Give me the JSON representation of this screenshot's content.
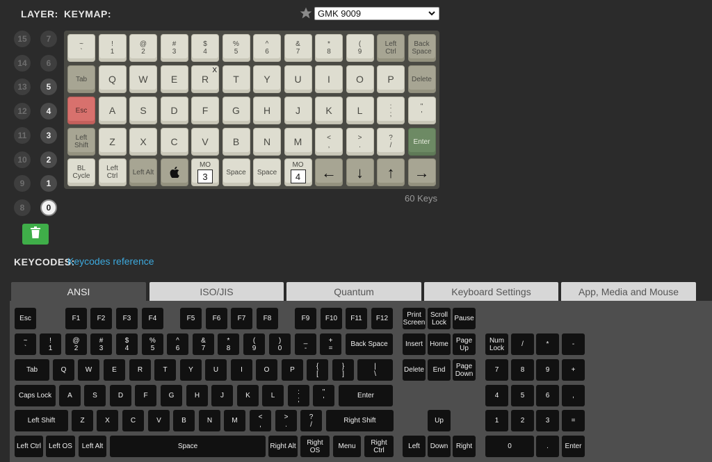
{
  "header": {
    "layer_label": "LAYER:",
    "keymap_label": "KEYMAP:",
    "preset_value": "GMK 9009",
    "preset_options": [
      "GMK 9009"
    ]
  },
  "layers": {
    "left": [
      "15",
      "14",
      "13",
      "12",
      "11",
      "10",
      "9",
      "8"
    ],
    "right": [
      "7",
      "6",
      "5",
      "4",
      "3",
      "2",
      "1",
      "0"
    ],
    "active": "0"
  },
  "colors": {
    "accent_link": "#3da9dd",
    "trash_green": "#3fae49",
    "keycap_light": "#deddd0",
    "keycap_dark": "#a7a593",
    "keycap_red": "#d8716d",
    "keycap_green": "#6d8a64"
  },
  "keymap_rows": [
    [
      {
        "t": "~",
        "b": "`",
        "s": "c1"
      },
      {
        "t": "!",
        "b": "1",
        "s": "c1"
      },
      {
        "t": "@",
        "b": "2",
        "s": "c1"
      },
      {
        "t": "#",
        "b": "3",
        "s": "c1"
      },
      {
        "t": "$",
        "b": "4",
        "s": "c1"
      },
      {
        "t": "%",
        "b": "5",
        "s": "c1"
      },
      {
        "t": "^",
        "b": "6",
        "s": "c1"
      },
      {
        "t": "&",
        "b": "7",
        "s": "c1"
      },
      {
        "t": "*",
        "b": "8",
        "s": "c1"
      },
      {
        "t": "(",
        "b": "9",
        "s": "c1"
      },
      {
        "t": "Left",
        "b": "Ctrl",
        "s": "c2"
      },
      {
        "t": "Back",
        "b": "Space",
        "s": "c2"
      }
    ],
    [
      {
        "l": "Tab",
        "s": "c2",
        "sz": "md"
      },
      {
        "l": "Q",
        "s": "c1"
      },
      {
        "l": "W",
        "s": "c1"
      },
      {
        "l": "E",
        "s": "c1"
      },
      {
        "l": "R",
        "s": "c1",
        "x": "X"
      },
      {
        "l": "T",
        "s": "c1"
      },
      {
        "l": "Y",
        "s": "c1"
      },
      {
        "l": "U",
        "s": "c1"
      },
      {
        "l": "I",
        "s": "c1"
      },
      {
        "l": "O",
        "s": "c1"
      },
      {
        "l": "P",
        "s": "c1"
      },
      {
        "l": "Delete",
        "s": "c2",
        "sz": "md"
      }
    ],
    [
      {
        "l": "Esc",
        "s": "red",
        "sz": "md"
      },
      {
        "l": "A",
        "s": "c1"
      },
      {
        "l": "S",
        "s": "c1"
      },
      {
        "l": "D",
        "s": "c1"
      },
      {
        "l": "F",
        "s": "c1"
      },
      {
        "l": "G",
        "s": "c1"
      },
      {
        "l": "H",
        "s": "c1"
      },
      {
        "l": "J",
        "s": "c1"
      },
      {
        "l": "K",
        "s": "c1"
      },
      {
        "l": "L",
        "s": "c1"
      },
      {
        "t": ":",
        "b": ";",
        "s": "c1"
      },
      {
        "t": "\"",
        "b": "'",
        "s": "c1"
      }
    ],
    [
      {
        "t": "Left",
        "b": "Shift",
        "s": "c2"
      },
      {
        "l": "Z",
        "s": "c1"
      },
      {
        "l": "X",
        "s": "c1"
      },
      {
        "l": "C",
        "s": "c1"
      },
      {
        "l": "V",
        "s": "c1"
      },
      {
        "l": "B",
        "s": "c1"
      },
      {
        "l": "N",
        "s": "c1"
      },
      {
        "l": "M",
        "s": "c1"
      },
      {
        "t": "<",
        "b": ",",
        "s": "c1"
      },
      {
        "t": ">",
        "b": ".",
        "s": "c1"
      },
      {
        "t": "?",
        "b": "/",
        "s": "c1"
      },
      {
        "l": "Enter",
        "s": "green",
        "sz": "md"
      }
    ],
    [
      {
        "t": "BL",
        "b": "Cycle",
        "s": "c1"
      },
      {
        "t": "Left",
        "b": "Ctrl",
        "s": "c1"
      },
      {
        "l": "Left Alt",
        "s": "c2",
        "sz": "md"
      },
      {
        "icon": "apple",
        "s": "c2"
      },
      {
        "mo": "3",
        "s": "c1"
      },
      {
        "l": "Space",
        "s": "c1",
        "sz": "md"
      },
      {
        "l": "Space",
        "s": "c1",
        "sz": "md"
      },
      {
        "mo": "4",
        "s": "c1"
      },
      {
        "arrow": "←",
        "s": "c2"
      },
      {
        "arrow": "↓",
        "s": "c2"
      },
      {
        "arrow": "↑",
        "s": "c2"
      },
      {
        "arrow": "→",
        "s": "c2"
      }
    ]
  ],
  "mo_label": "MO",
  "key_count": "60 Keys",
  "keycodes": {
    "label": "KEYCODES:",
    "link": "Keycodes reference"
  },
  "tabs": [
    "ANSI",
    "ISO/JIS",
    "Quantum",
    "Keyboard Settings",
    "App, Media and Mouse"
  ],
  "ansi_keys": [
    {
      "l": "Esc"
    },
    {
      "l": "F1"
    },
    {
      "l": "F2"
    },
    {
      "l": "F3"
    },
    {
      "l": "F4"
    },
    {
      "l": "F5"
    },
    {
      "l": "F6"
    },
    {
      "l": "F7"
    },
    {
      "l": "F8"
    },
    {
      "l": "F9"
    },
    {
      "l": "F10"
    },
    {
      "l": "F11"
    },
    {
      "l": "F12"
    },
    {
      "t": "Print",
      "b": "Screen"
    },
    {
      "t": "Scroll",
      "b": "Lock"
    },
    {
      "l": "Pause"
    },
    {
      "t": "~",
      "b": "`"
    },
    {
      "t": "!",
      "b": "1"
    },
    {
      "t": "@",
      "b": "2"
    },
    {
      "t": "#",
      "b": "3"
    },
    {
      "t": "$",
      "b": "4"
    },
    {
      "t": "%",
      "b": "5"
    },
    {
      "t": "^",
      "b": "6"
    },
    {
      "t": "&",
      "b": "7"
    },
    {
      "t": "*",
      "b": "8"
    },
    {
      "t": "(",
      "b": "9"
    },
    {
      "t": ")",
      "b": "0"
    },
    {
      "t": "_",
      "b": "-"
    },
    {
      "t": "+",
      "b": "="
    },
    {
      "l": "Back Space"
    },
    {
      "l": "Insert"
    },
    {
      "l": "Home"
    },
    {
      "t": "Page",
      "b": "Up"
    },
    {
      "t": "Num",
      "b": "Lock"
    },
    {
      "l": "/"
    },
    {
      "l": "*"
    },
    {
      "l": "-"
    },
    {
      "l": "Tab"
    },
    {
      "l": "Q"
    },
    {
      "l": "W"
    },
    {
      "l": "E"
    },
    {
      "l": "R"
    },
    {
      "l": "T"
    },
    {
      "l": "Y"
    },
    {
      "l": "U"
    },
    {
      "l": "I"
    },
    {
      "l": "O"
    },
    {
      "l": "P"
    },
    {
      "t": "{",
      "b": "["
    },
    {
      "t": "}",
      "b": "]"
    },
    {
      "t": "|",
      "b": "\\"
    },
    {
      "l": "Delete"
    },
    {
      "l": "End"
    },
    {
      "t": "Page",
      "b": "Down"
    },
    {
      "l": "7"
    },
    {
      "l": "8"
    },
    {
      "l": "9"
    },
    {
      "l": "+"
    },
    {
      "l": "Caps Lock"
    },
    {
      "l": "A"
    },
    {
      "l": "S"
    },
    {
      "l": "D"
    },
    {
      "l": "F"
    },
    {
      "l": "G"
    },
    {
      "l": "H"
    },
    {
      "l": "J"
    },
    {
      "l": "K"
    },
    {
      "l": "L"
    },
    {
      "t": ":",
      "b": ";"
    },
    {
      "t": "\"",
      "b": "'"
    },
    {
      "l": "Enter"
    },
    {
      "l": "4"
    },
    {
      "l": "5"
    },
    {
      "l": "6"
    },
    {
      "l": ","
    },
    {
      "l": "Left Shift"
    },
    {
      "l": "Z"
    },
    {
      "l": "X"
    },
    {
      "l": "C"
    },
    {
      "l": "V"
    },
    {
      "l": "B"
    },
    {
      "l": "N"
    },
    {
      "l": "M"
    },
    {
      "t": "<",
      "b": ","
    },
    {
      "t": ">",
      "b": "."
    },
    {
      "t": "?",
      "b": "/"
    },
    {
      "l": "Right Shift"
    },
    {
      "l": "Up"
    },
    {
      "l": "1"
    },
    {
      "l": "2"
    },
    {
      "l": "3"
    },
    {
      "l": "="
    },
    {
      "l": "Left Ctrl"
    },
    {
      "l": "Left OS"
    },
    {
      "l": "Left Alt"
    },
    {
      "l": "Space"
    },
    {
      "l": "Right Alt"
    },
    {
      "t": "Right",
      "b": "OS"
    },
    {
      "l": "Menu"
    },
    {
      "t": "Right",
      "b": "Ctrl"
    },
    {
      "l": "Left"
    },
    {
      "l": "Down"
    },
    {
      "l": "Right"
    },
    {
      "l": "0"
    },
    {
      "l": "."
    },
    {
      "l": "Enter"
    }
  ]
}
